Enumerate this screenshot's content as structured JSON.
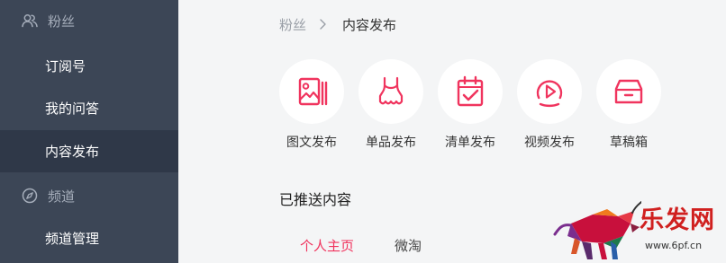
{
  "sidebar": {
    "fans": "粉丝",
    "subscription": "订阅号",
    "my_qa": "我的问答",
    "content_publish": "内容发布",
    "channel": "频道",
    "channel_manage": "频道管理"
  },
  "breadcrumb": {
    "parent": "粉丝",
    "current": "内容发布"
  },
  "actions": [
    {
      "label": "图文发布",
      "icon": "image-text-icon"
    },
    {
      "label": "单品发布",
      "icon": "product-dress-icon"
    },
    {
      "label": "清单发布",
      "icon": "checklist-icon"
    },
    {
      "label": "视频发布",
      "icon": "video-play-icon"
    },
    {
      "label": "草稿箱",
      "icon": "drafts-box-icon"
    }
  ],
  "pushed_section": {
    "title": "已推送内容",
    "tabs": [
      "个人主页",
      "微淘"
    ],
    "active_tab": 0
  },
  "watermark": {
    "text": "乐发网",
    "url": "www.6pf.cn"
  },
  "colors": {
    "accent": "#f0345e",
    "sidebar_bg": "#3c4656",
    "sidebar_active_bg": "#2f3848",
    "sidebar_section_text": "#a5adba",
    "main_bg": "#f4f5f6"
  }
}
